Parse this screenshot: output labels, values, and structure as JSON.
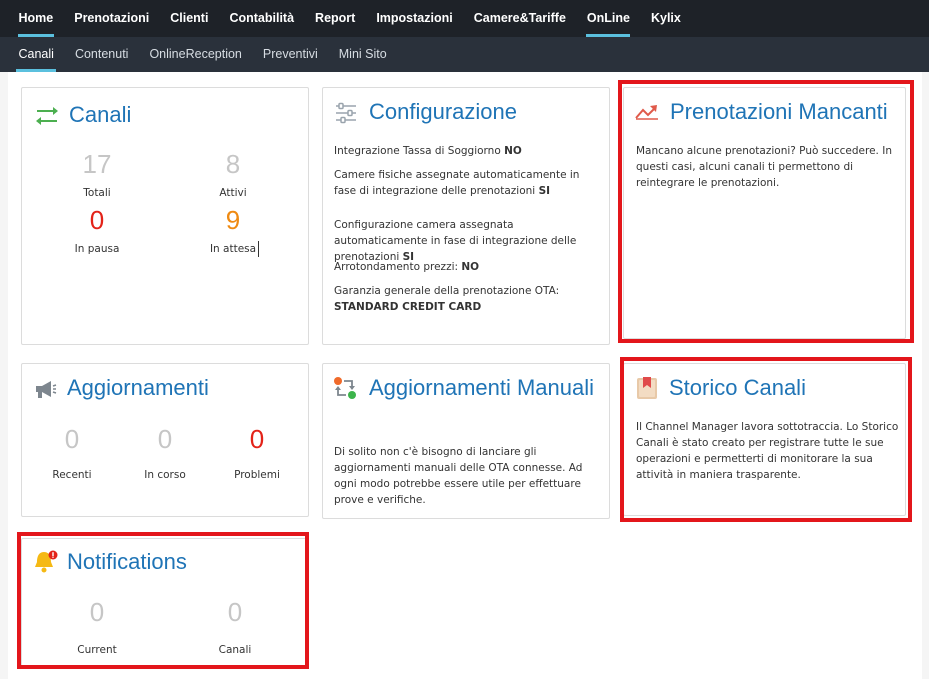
{
  "topnav": {
    "items": [
      "Home",
      "Prenotazioni",
      "Clienti",
      "Contabilità",
      "Report",
      "Impostazioni",
      "Camere&Tariffe",
      "OnLine",
      "Kylix"
    ]
  },
  "subnav": {
    "items": [
      "Canali",
      "Contenuti",
      "OnlineReception",
      "Preventivi",
      "Mini Sito"
    ]
  },
  "canali": {
    "title": "Canali",
    "totali_value": "17",
    "totali_label": "Totali",
    "attivi_value": "8",
    "attivi_label": "Attivi",
    "pausa_value": "0",
    "pausa_label": "In pausa",
    "attesa_value": "9",
    "attesa_label": "In attesa"
  },
  "configurazione": {
    "title": "Configurazione",
    "line1_text": "Integrazione Tassa di Soggiorno ",
    "line1_value": "NO",
    "line2_text": "Camere fisiche assegnate automaticamente in fase di integrazione delle prenotazioni ",
    "line2_value": "SI",
    "line3_text": "Configurazione camera assegnata automaticamente in fase di integrazione delle prenotazioni ",
    "line3_value": "SI",
    "line4_text": "Arrotondamento prezzi: ",
    "line4_value": "NO",
    "line5_text": "Garanzia generale della prenotazione OTA:",
    "line5_value": "STANDARD CREDIT CARD"
  },
  "prenotazioni_mancanti": {
    "title": "Prenotazioni Mancanti",
    "text": "Mancano alcune prenotazioni? Può succedere. In questi casi, alcuni canali ti permettono di reintegrare le prenotazioni."
  },
  "aggiornamenti": {
    "title": "Aggiornamenti",
    "recenti_value": "0",
    "recenti_label": "Recenti",
    "corso_value": "0",
    "corso_label": "In corso",
    "problemi_value": "0",
    "problemi_label": "Problemi"
  },
  "aggiornamenti_manuali": {
    "title": "Aggiornamenti Manuali",
    "text": "Di solito non c'è bisogno di lanciare gli aggiornamenti manuali delle OTA connesse. Ad ogni modo potrebbe essere utile per effettuare prove e verifiche."
  },
  "storico_canali": {
    "title": "Storico Canali",
    "text": "Il Channel Manager lavora sottotraccia. Lo Storico Canali è stato creato per registrare tutte le sue operazioni e permetterti di monitorare la sua attività in maniera trasparente."
  },
  "notifications": {
    "title": "Notifications",
    "current_value": "0",
    "current_label": "Current",
    "canali_value": "0",
    "canali_label": "Canali"
  },
  "colors": {
    "accent": "#1f74b6",
    "highlight": "#e3161b",
    "red": "#e32319",
    "orange": "#ef8a12"
  }
}
